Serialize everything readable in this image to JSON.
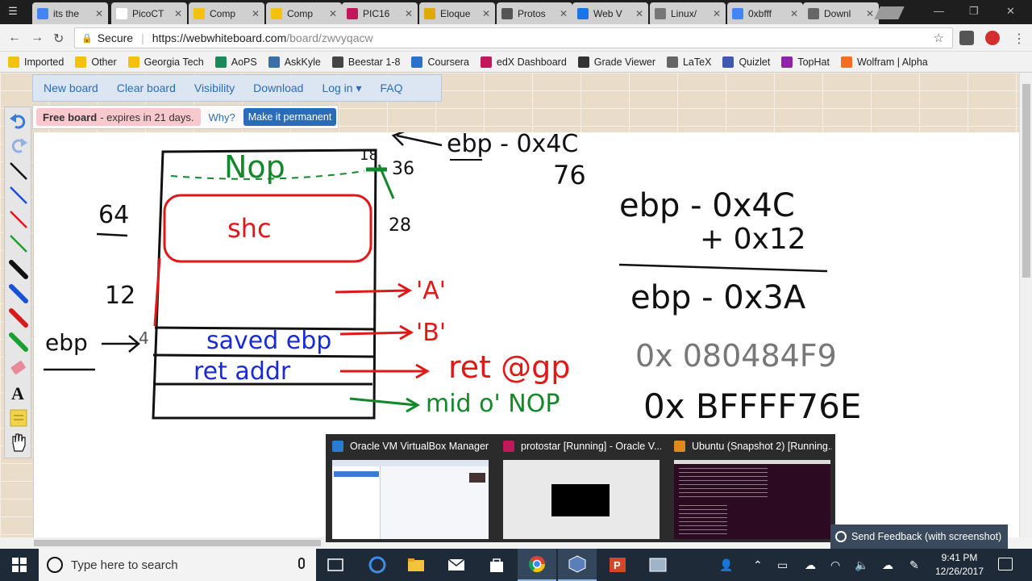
{
  "browser": {
    "tabs": [
      {
        "title": "its the",
        "color": "#4285f4"
      },
      {
        "title": "PicoCT",
        "color": "#ffffff"
      },
      {
        "title": "Comp",
        "color": "#f4c20d"
      },
      {
        "title": "Comp",
        "color": "#f4c20d"
      },
      {
        "title": "PIC16",
        "color": "#c2185b"
      },
      {
        "title": "Eloque",
        "color": "#e0a800"
      },
      {
        "title": "Protos",
        "color": "#555555"
      },
      {
        "title": "Web V",
        "color": "#1a73e8"
      },
      {
        "title": "Linux/",
        "color": "#777777"
      },
      {
        "title": "0xbfff",
        "color": "#4285f4"
      },
      {
        "title": "Downl",
        "color": "#666666"
      }
    ],
    "secure_label": "Secure",
    "url_host": "https://webwhiteboard.com",
    "url_path": "/board/zwvyqacw"
  },
  "bookmarks": [
    {
      "label": "Imported",
      "color": "#f4c20d"
    },
    {
      "label": "Other",
      "color": "#f4c20d"
    },
    {
      "label": "Georgia Tech",
      "color": "#f4c20d"
    },
    {
      "label": "AoPS",
      "color": "#1b8a5a"
    },
    {
      "label": "AskKyle",
      "color": "#3a6ea5"
    },
    {
      "label": "Beestar 1-8",
      "color": "#444444"
    },
    {
      "label": "Coursera",
      "color": "#2a73cc"
    },
    {
      "label": "edX Dashboard",
      "color": "#c2185b"
    },
    {
      "label": "Grade Viewer",
      "color": "#333333"
    },
    {
      "label": "LaTeX",
      "color": "#666666"
    },
    {
      "label": "Quizlet",
      "color": "#4257b2"
    },
    {
      "label": "TopHat",
      "color": "#8e24aa"
    },
    {
      "label": "Wolfram | Alpha",
      "color": "#f36e1e"
    }
  ],
  "board": {
    "nav": [
      "New board",
      "Clear board",
      "Visibility",
      "Download",
      "Log in ▾",
      "FAQ"
    ],
    "free_label": "Free board",
    "free_rest": "- expires in 21 days.",
    "why_label": "Why?",
    "permanent_label": "Make it permanent"
  },
  "drawing": {
    "nop_label": "Nop",
    "shc_label": "shc",
    "saved_ebp_label": "saved ebp",
    "ret_addr_label": "ret addr",
    "a_label": "'A'",
    "b_label": "'B'",
    "ret_gp_label": "ret @gp",
    "mid_nop_label": "mid o' NOP",
    "ebp_label": "ebp",
    "ebp_0x4c_label": "ebp - 0x4C",
    "n76": "76",
    "n64": "64",
    "n12": "12",
    "n18": "18",
    "n36": "36",
    "n28": "28",
    "n4": "4",
    "calc_top": "ebp - 0x4C",
    "calc_plus": "+ 0x12",
    "calc_result": "ebp - 0x3A",
    "addr1": "0x 080484F9",
    "addr2": "0x BFFFF76E"
  },
  "taskview": [
    {
      "title": "Oracle VM VirtualBox Manager",
      "color": "#2a7bd1"
    },
    {
      "title": "protostar [Running] - Oracle V...",
      "color": "#c2185b"
    },
    {
      "title": "Ubuntu (Snapshot 2) [Running...",
      "color": "#e08a1e"
    }
  ],
  "feedback_label": "Send Feedback (with screenshot)",
  "taskbar": {
    "search_placeholder": "Type here to search",
    "time": "9:41 PM",
    "date": "12/26/2017"
  },
  "colors": {
    "accent_link": "#2a6db6",
    "pen_red": "#e01818",
    "pen_green": "#12882a",
    "pen_blue": "#1a2ad8",
    "pen_black": "#111111"
  }
}
